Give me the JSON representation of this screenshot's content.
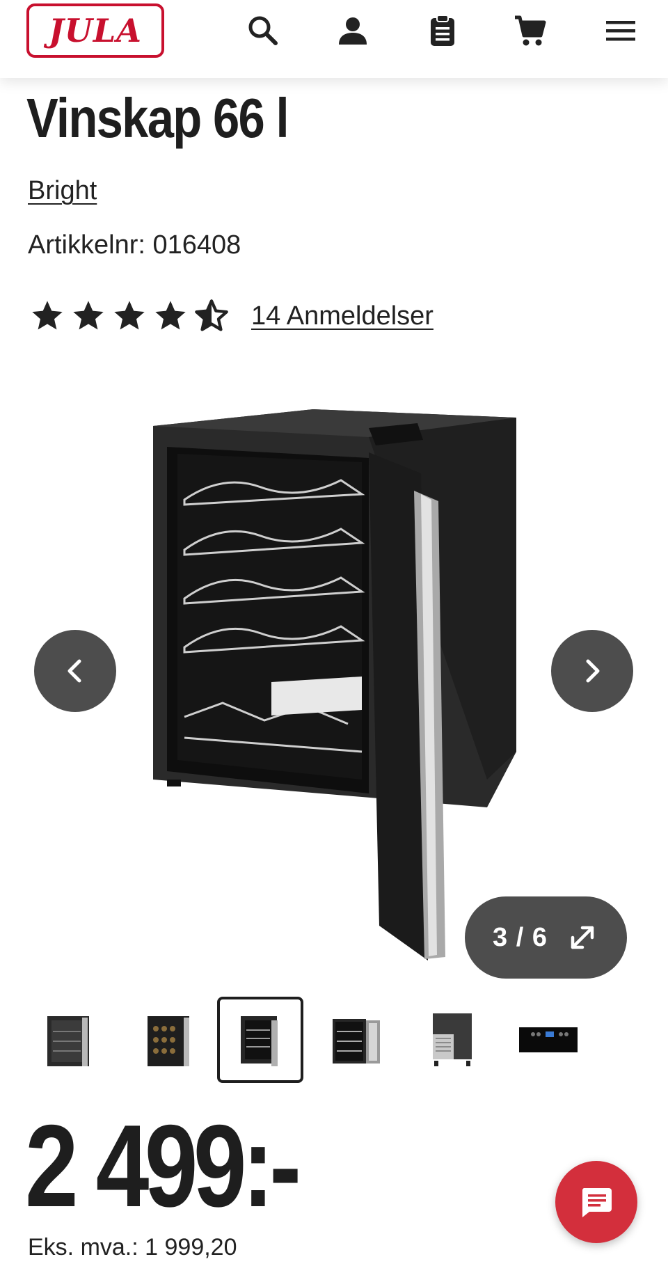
{
  "header": {
    "logo_text": "JULA",
    "icons": [
      "search-icon",
      "user-icon",
      "clipboard-icon",
      "cart-icon",
      "menu-icon"
    ]
  },
  "product": {
    "title": "Vinskap 66 l",
    "brand": "Bright",
    "article_label": "Artikkelnr:",
    "article_number": "016408",
    "rating": {
      "value": 4.5,
      "max": 5
    },
    "reviews_text": "14 Anmeldelser"
  },
  "gallery": {
    "counter": "3 / 6",
    "current": 3,
    "total": 6,
    "thumbnails": [
      "thumb-closed-front",
      "thumb-filled-bottles",
      "thumb-open-door",
      "thumb-open-side",
      "thumb-back",
      "thumb-control-panel"
    ],
    "selected_index": 2
  },
  "price": {
    "amount": "2 499:-",
    "ex_vat_label": "Eks. mva.:",
    "ex_vat_value": "1 999,20"
  },
  "colors": {
    "brand_red": "#c8102e",
    "chat_red": "#d32f3c",
    "nav_gray": "#4d4d4d",
    "text": "#222222"
  }
}
